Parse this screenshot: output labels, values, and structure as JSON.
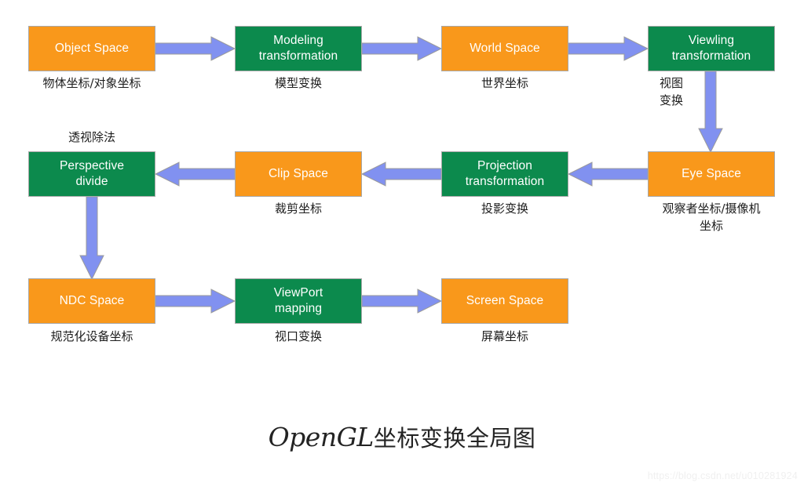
{
  "figure": {
    "caption_latin": "OpenGL",
    "caption_cn": "坐标变换全局图",
    "watermark": "https://blog.csdn.net/u010281924"
  },
  "palette": {
    "space_fill": "#F9981B",
    "transform_fill": "#0C8A4D",
    "arrow_fill": "#8191F0",
    "arrow_stroke": "#9a9a9a",
    "box_stroke": "#a8a8a8",
    "label_text": "#1d1d1d",
    "node_text": "#ffffff"
  },
  "nodes": [
    {
      "id": "object-space",
      "line1": "Object Space",
      "line2": "",
      "kind": "space",
      "caption": "物体坐标/对象坐标",
      "caption2": ""
    },
    {
      "id": "modeling-transformation",
      "line1": "Modeling",
      "line2": "transformation",
      "kind": "transform",
      "caption": "模型变换",
      "caption2": ""
    },
    {
      "id": "world-space",
      "line1": "World Space",
      "line2": "",
      "kind": "space",
      "caption": "世界坐标",
      "caption2": ""
    },
    {
      "id": "viewing-transformation",
      "line1": "Viewling",
      "line2": "transformation",
      "kind": "transform",
      "caption": "视图",
      "caption2": "变换"
    },
    {
      "id": "eye-space",
      "line1": "Eye Space",
      "line2": "",
      "kind": "space",
      "caption": "观察者坐标/摄像机",
      "caption2": "坐标"
    },
    {
      "id": "projection-transformation",
      "line1": "Projection",
      "line2": "transformation",
      "kind": "transform",
      "caption": "投影变换",
      "caption2": ""
    },
    {
      "id": "clip-space",
      "line1": "Clip Space",
      "line2": "",
      "kind": "space",
      "caption": "裁剪坐标",
      "caption2": ""
    },
    {
      "id": "perspective-divide",
      "line1": "Perspective",
      "line2": "divide",
      "kind": "transform",
      "caption_above": "透视除法",
      "caption": "",
      "caption2": ""
    },
    {
      "id": "ndc-space",
      "line1": "NDC Space",
      "line2": "",
      "kind": "space",
      "caption": "规范化设备坐标",
      "caption2": ""
    },
    {
      "id": "viewport-mapping",
      "line1": "ViewPort",
      "line2": "mapping",
      "kind": "transform",
      "caption": "视口变换",
      "caption2": ""
    },
    {
      "id": "screen-space",
      "line1": "Screen Space",
      "line2": "",
      "kind": "space",
      "caption": "屏幕坐标",
      "caption2": ""
    }
  ],
  "flow": [
    {
      "from": "object-space",
      "to": "modeling-transformation",
      "direction": "right"
    },
    {
      "from": "modeling-transformation",
      "to": "world-space",
      "direction": "right"
    },
    {
      "from": "world-space",
      "to": "viewing-transformation",
      "direction": "right"
    },
    {
      "from": "viewing-transformation",
      "to": "eye-space",
      "direction": "down"
    },
    {
      "from": "eye-space",
      "to": "projection-transformation",
      "direction": "left"
    },
    {
      "from": "projection-transformation",
      "to": "clip-space",
      "direction": "left"
    },
    {
      "from": "clip-space",
      "to": "perspective-divide",
      "direction": "left"
    },
    {
      "from": "perspective-divide",
      "to": "ndc-space",
      "direction": "down"
    },
    {
      "from": "ndc-space",
      "to": "viewport-mapping",
      "direction": "right"
    },
    {
      "from": "viewport-mapping",
      "to": "screen-space",
      "direction": "right"
    }
  ]
}
